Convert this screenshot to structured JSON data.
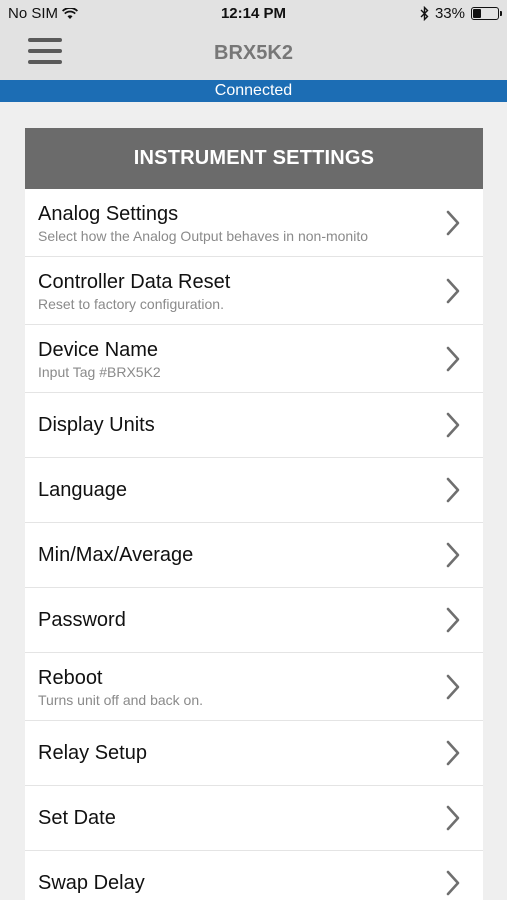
{
  "status_bar": {
    "carrier": "No SIM",
    "time": "12:14 PM",
    "battery_percent": "33%",
    "battery_level": 0.33
  },
  "nav": {
    "title": "BRX5K2",
    "menu_icon": "hamburger-menu-icon"
  },
  "connection": {
    "status": "Connected",
    "color": "#1c6db4"
  },
  "panel": {
    "header": "INSTRUMENT SETTINGS",
    "items": [
      {
        "title": "Analog Settings",
        "subtitle": "Select how the Analog Output behaves in non-monito"
      },
      {
        "title": "Controller Data Reset",
        "subtitle": "Reset to factory configuration."
      },
      {
        "title": "Device Name",
        "subtitle": "Input Tag #BRX5K2"
      },
      {
        "title": "Display Units",
        "subtitle": ""
      },
      {
        "title": "Language",
        "subtitle": ""
      },
      {
        "title": "Min/Max/Average",
        "subtitle": ""
      },
      {
        "title": "Password",
        "subtitle": ""
      },
      {
        "title": "Reboot",
        "subtitle": "Turns unit off and back on."
      },
      {
        "title": "Relay Setup",
        "subtitle": ""
      },
      {
        "title": "Set Date",
        "subtitle": ""
      },
      {
        "title": "Swap Delay",
        "subtitle": ""
      }
    ]
  }
}
